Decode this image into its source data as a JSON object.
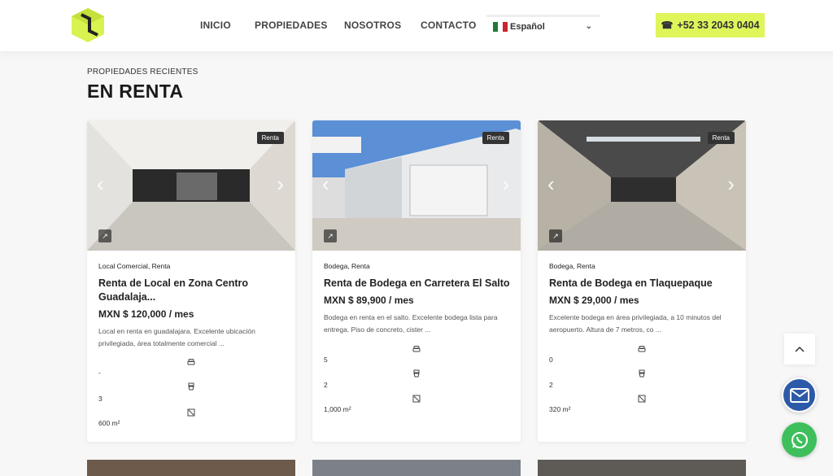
{
  "header": {
    "nav": [
      "INICIO",
      "PROPIEDADES",
      "NOSOTROS",
      "CONTACTO"
    ],
    "language": "Español",
    "phone": "+52 33 2043 0404"
  },
  "section": {
    "eyebrow": "PROPIEDADES RECIENTES",
    "title": "EN RENTA"
  },
  "cards": [
    {
      "badge": "Renta",
      "category": "Local Comercial, Renta",
      "title": "Renta de Local en Zona Centro Guadalaja...",
      "price": "MXN $ 120,000 / mes",
      "description": "Local en renta en guadalajara. Excelente ubicación privilegiada, área totalmente comercial ...",
      "parking": "-",
      "baths": "3",
      "area": "600 m²"
    },
    {
      "badge": "Renta",
      "category": "Bodega, Renta",
      "title": "Renta de Bodega en Carretera El Salto",
      "price": "MXN $ 89,900 / mes",
      "description": "Bodega en renta en el salto. Excelente bodega lista para entrega. Piso de concreto, cister ...",
      "parking": "5",
      "baths": "2",
      "area": "1,000 m²"
    },
    {
      "badge": "Renta",
      "category": "Bodega, Renta",
      "title": "Renta de Bodega en Tlaquepaque",
      "price": "MXN $ 29,000 / mes",
      "description": "Excelente bodega en área privilegiada, a 10 minutos del aeropuerto. Altura de 7 metros, co ...",
      "parking": "0",
      "baths": "2",
      "area": "320 m²"
    }
  ],
  "colors": {
    "accent": "#dff55a",
    "email": "#2d5aa8",
    "whatsapp": "#3fbf5c"
  }
}
